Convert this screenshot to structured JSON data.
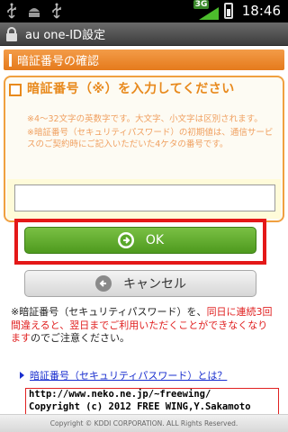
{
  "status_bar": {
    "network": "3G",
    "time": "18:46",
    "icons": [
      "usb-icon",
      "android-debug-icon",
      "usb-icon",
      "signal-3g-icon",
      "battery-icon"
    ]
  },
  "title_bar": {
    "title": "au one-ID設定",
    "icon": "lock-icon"
  },
  "section": {
    "header": "暗証番号の確認"
  },
  "form": {
    "label": "暗証番号（※）を入力してください",
    "notes": [
      "※4〜32文字の英数字です。大文字、小文字は区別されます。",
      "※暗証番号（セキュリティパスワード）の初期値は、通信サービスのご契約時にご記入いただいた4ケタの番号です。"
    ],
    "pin_value": "",
    "pin_placeholder": ""
  },
  "buttons": {
    "ok_label": "OK",
    "cancel_label": "キャンセル"
  },
  "warning": {
    "part1": "※暗証番号（セキュリティパスワード）を、",
    "red": "同日に連続3回間違えると、翌日までご利用いただくことができなくなります",
    "part2": "のでご注意ください。"
  },
  "help_link": "暗証番号（セキュリティパスワード）とは？",
  "watermark": {
    "line1": "http://www.neko.ne.jp/~freewing/",
    "line2": "Copyright (c) 2012 FREE WING,Y.Sakamoto"
  },
  "footer": "Copyright © KDDI CORPORATION. ALL Rights Reserved.",
  "colors": {
    "accent_orange": "#e8891c",
    "ok_green": "#5aa82a",
    "highlight_red": "#e41818",
    "link_blue": "#1a2fcf"
  }
}
